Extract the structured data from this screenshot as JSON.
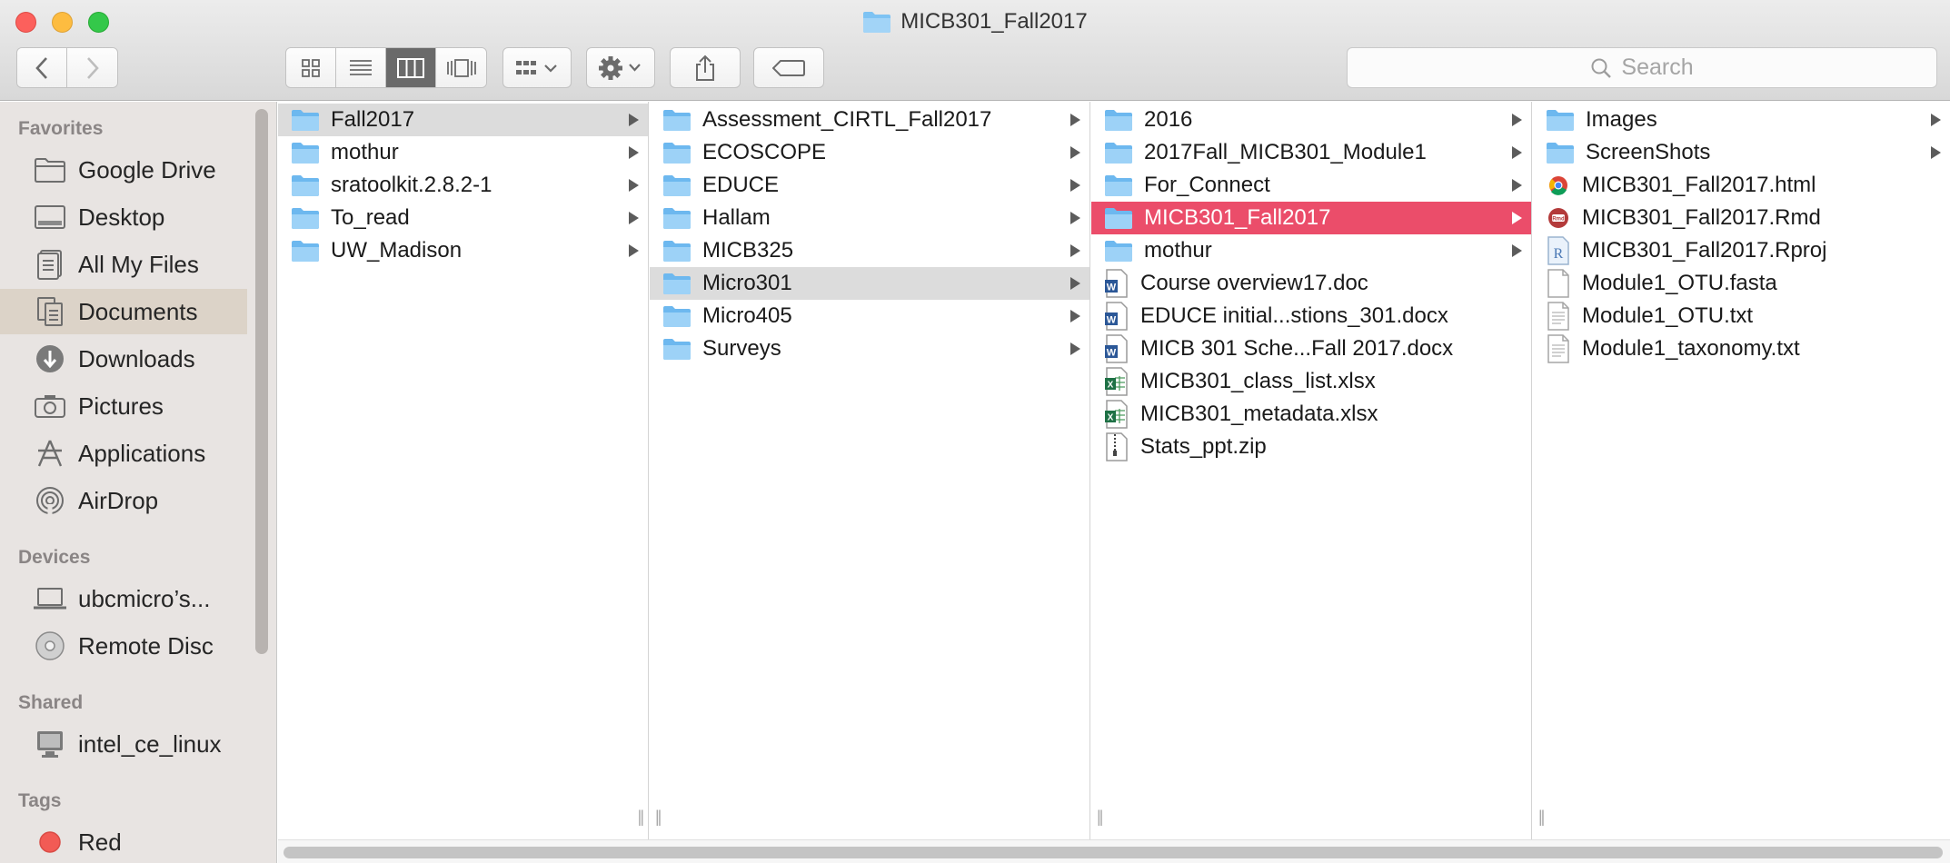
{
  "window": {
    "title": "MICB301_Fall2017"
  },
  "toolbar": {
    "search_placeholder": "Search"
  },
  "sidebar": {
    "sections": [
      {
        "heading": "Favorites",
        "items": [
          {
            "label": "Google Drive",
            "icon": "folder-icon"
          },
          {
            "label": "Desktop",
            "icon": "desktop-icon"
          },
          {
            "label": "All My Files",
            "icon": "all-files-icon"
          },
          {
            "label": "Documents",
            "icon": "documents-icon",
            "selected": true
          },
          {
            "label": "Downloads",
            "icon": "downloads-icon"
          },
          {
            "label": "Pictures",
            "icon": "camera-icon"
          },
          {
            "label": "Applications",
            "icon": "applications-icon"
          },
          {
            "label": "AirDrop",
            "icon": "airdrop-icon"
          }
        ]
      },
      {
        "heading": "Devices",
        "items": [
          {
            "label": "ubcmicro’s...",
            "icon": "laptop-icon"
          },
          {
            "label": "Remote Disc",
            "icon": "disc-icon"
          }
        ]
      },
      {
        "heading": "Shared",
        "items": [
          {
            "label": "intel_ce_linux",
            "icon": "computer-icon"
          }
        ]
      },
      {
        "heading": "Tags",
        "items": [
          {
            "label": "Red",
            "icon": "red-tag-icon"
          }
        ]
      }
    ]
  },
  "columns": [
    {
      "items": [
        {
          "name": "Fall2017",
          "type": "folder",
          "state": "path"
        },
        {
          "name": "mothur",
          "type": "folder"
        },
        {
          "name": "sratoolkit.2.8.2-1",
          "type": "folder"
        },
        {
          "name": "To_read",
          "type": "folder"
        },
        {
          "name": "UW_Madison",
          "type": "folder"
        }
      ]
    },
    {
      "items": [
        {
          "name": "Assessment_CIRTL_Fall2017",
          "type": "folder"
        },
        {
          "name": "ECOSCOPE",
          "type": "folder"
        },
        {
          "name": "EDUCE",
          "type": "folder"
        },
        {
          "name": "Hallam",
          "type": "folder"
        },
        {
          "name": "MICB325",
          "type": "folder"
        },
        {
          "name": "Micro301",
          "type": "folder",
          "state": "path"
        },
        {
          "name": "Micro405",
          "type": "folder"
        },
        {
          "name": "Surveys",
          "type": "folder"
        }
      ]
    },
    {
      "items": [
        {
          "name": "2016",
          "type": "folder"
        },
        {
          "name": "2017Fall_MICB301_Module1",
          "type": "folder"
        },
        {
          "name": "For_Connect",
          "type": "folder"
        },
        {
          "name": "MICB301_Fall2017",
          "type": "folder",
          "state": "selected"
        },
        {
          "name": "mothur",
          "type": "folder"
        },
        {
          "name": "Course overview17.doc",
          "type": "word"
        },
        {
          "name": "EDUCE initial...stions_301.docx",
          "type": "word"
        },
        {
          "name": "MICB 301 Sche...Fall 2017.docx",
          "type": "word"
        },
        {
          "name": "MICB301_class_list.xlsx",
          "type": "excel"
        },
        {
          "name": "MICB301_metadata.xlsx",
          "type": "excel"
        },
        {
          "name": "Stats_ppt.zip",
          "type": "zip"
        }
      ]
    },
    {
      "items": [
        {
          "name": "Images",
          "type": "folder"
        },
        {
          "name": "ScreenShots",
          "type": "folder"
        },
        {
          "name": "MICB301_Fall2017.html",
          "type": "html"
        },
        {
          "name": "MICB301_Fall2017.Rmd",
          "type": "rmd"
        },
        {
          "name": "MICB301_Fall2017.Rproj",
          "type": "rproj"
        },
        {
          "name": "Module1_OTU.fasta",
          "type": "blank"
        },
        {
          "name": "Module1_OTU.txt",
          "type": "text"
        },
        {
          "name": "Module1_taxonomy.txt",
          "type": "text"
        }
      ]
    }
  ],
  "colors": {
    "selection": "#eb4d6a",
    "folder": "#7ec3f3",
    "sidebar_bg": "#e8e4e2"
  }
}
